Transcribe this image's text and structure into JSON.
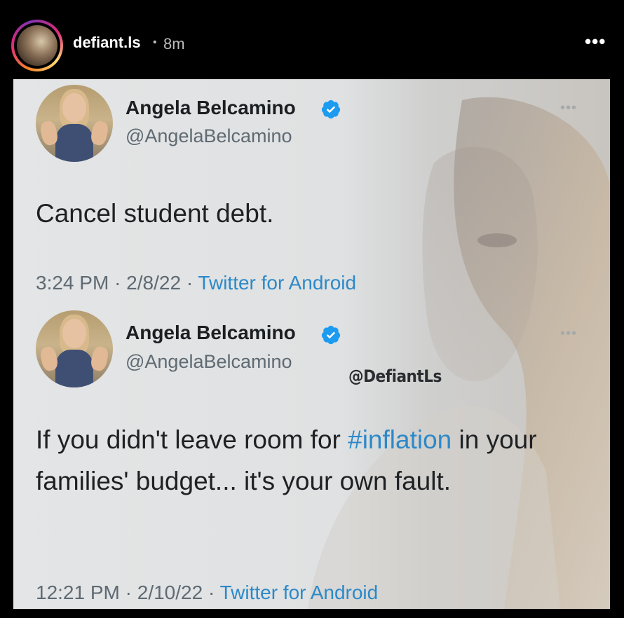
{
  "post_header": {
    "username": "defiant.ls",
    "separator": "•",
    "time_ago": "8m",
    "more_label": "•••"
  },
  "tweets": [
    {
      "display_name": "Angela Belcamino",
      "handle": "@AngelaBelcamino",
      "more_label": "•••",
      "text": "Cancel student debt.",
      "time": "3:24 PM",
      "date": "2/8/22",
      "source": "Twitter for Android"
    },
    {
      "display_name": "Angela Belcamino",
      "handle": "@AngelaBelcamino",
      "more_label": "•••",
      "text_before": "If you didn't leave room for ",
      "hashtag": "#inflation",
      "text_after": " in your families' budget... it's your own fault.",
      "time": "12:21 PM",
      "date": "2/10/22",
      "source": "Twitter for Android"
    }
  ],
  "watermark": "@DefiantLs",
  "colors": {
    "link_blue": "#2c89c9",
    "verified_blue": "#1d9bf0",
    "background": "#000000"
  }
}
